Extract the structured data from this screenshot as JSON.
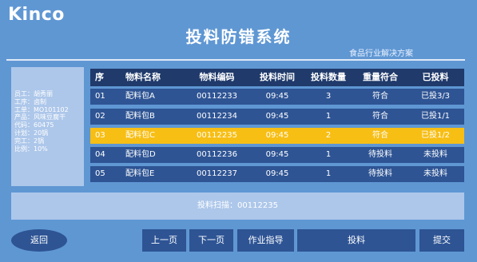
{
  "header": {
    "logo": "Kinco",
    "title": "投料防错系统",
    "subtitle": "食品行业解决方案"
  },
  "info": [
    "员工：胡秀丽",
    "工序：卤制",
    "工单：MO101102",
    "产品：风味豆腐干",
    "代码：60475",
    "计划：20锅",
    "完工：2锅",
    "比例：10%"
  ],
  "table": {
    "headers": [
      "序",
      "物料名称",
      "物料编码",
      "投料时间",
      "投料数量",
      "重量符合",
      "已投料"
    ],
    "rows": [
      [
        "01",
        "配料包A",
        "00112233",
        "09:45",
        "3",
        "符合",
        "已投3/3"
      ],
      [
        "02",
        "配料包B",
        "00112234",
        "09:45",
        "1",
        "符合",
        "已投1/1"
      ],
      [
        "03",
        "配料包C",
        "00112235",
        "09:45",
        "2",
        "符合",
        "已投1/2"
      ],
      [
        "04",
        "配料包D",
        "00112236",
        "09:45",
        "1",
        "待投料",
        "未投料"
      ],
      [
        "05",
        "配料包E",
        "00112237",
        "09:45",
        "1",
        "待投料",
        "未投料"
      ]
    ],
    "highlight_row": 2,
    "highlight_color": "#f7be14"
  },
  "scan": {
    "text": "投料扫描：00112235"
  },
  "buttons": {
    "back": "返回",
    "prev": "上一页",
    "next": "下一页",
    "guide": "作业指导",
    "feed": "投料",
    "submit": "提交"
  },
  "colors": {
    "background": "#5f97d3",
    "header_row": "#1f3a6b",
    "row": "#2e5494",
    "panel": "#adc7ea"
  }
}
